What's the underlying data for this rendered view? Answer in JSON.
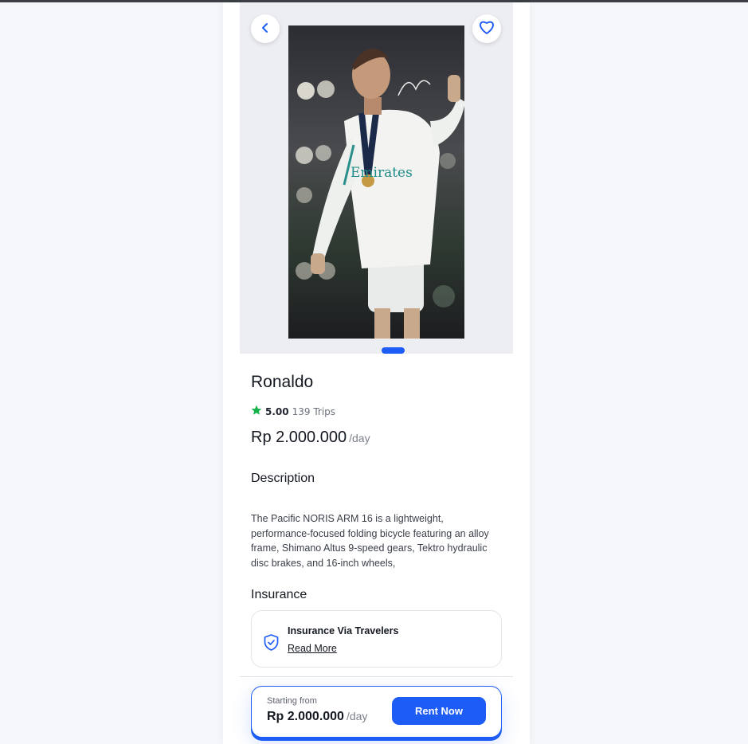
{
  "product": {
    "name": "Ronaldo",
    "rating": "5.00",
    "trips": "139 Trips",
    "price": "Rp 2.000.000",
    "price_unit": "/day",
    "image_alt": "Ronaldo"
  },
  "description": {
    "heading": "Description",
    "text": "The Pacific NORIS ARM 16 is a lightweight, performance-focused folding bicycle featuring an alloy frame, Shimano Altus 9-speed gears, Tektro hydraulic disc brakes, and 16-inch wheels,"
  },
  "insurance": {
    "heading": "Insurance",
    "provider": "Insurance Via Travelers",
    "link": "Read More"
  },
  "footer": {
    "starting_label": "Starting from",
    "price": "Rp 2.000.000",
    "price_unit": "/day",
    "cta": "Rent Now"
  },
  "colors": {
    "accent": "#1d5cf5",
    "star": "#16b34a",
    "background": "#f5f7fb"
  },
  "icons": [
    "chevron-left-icon",
    "heart-icon",
    "star-icon",
    "shield-check-icon"
  ]
}
